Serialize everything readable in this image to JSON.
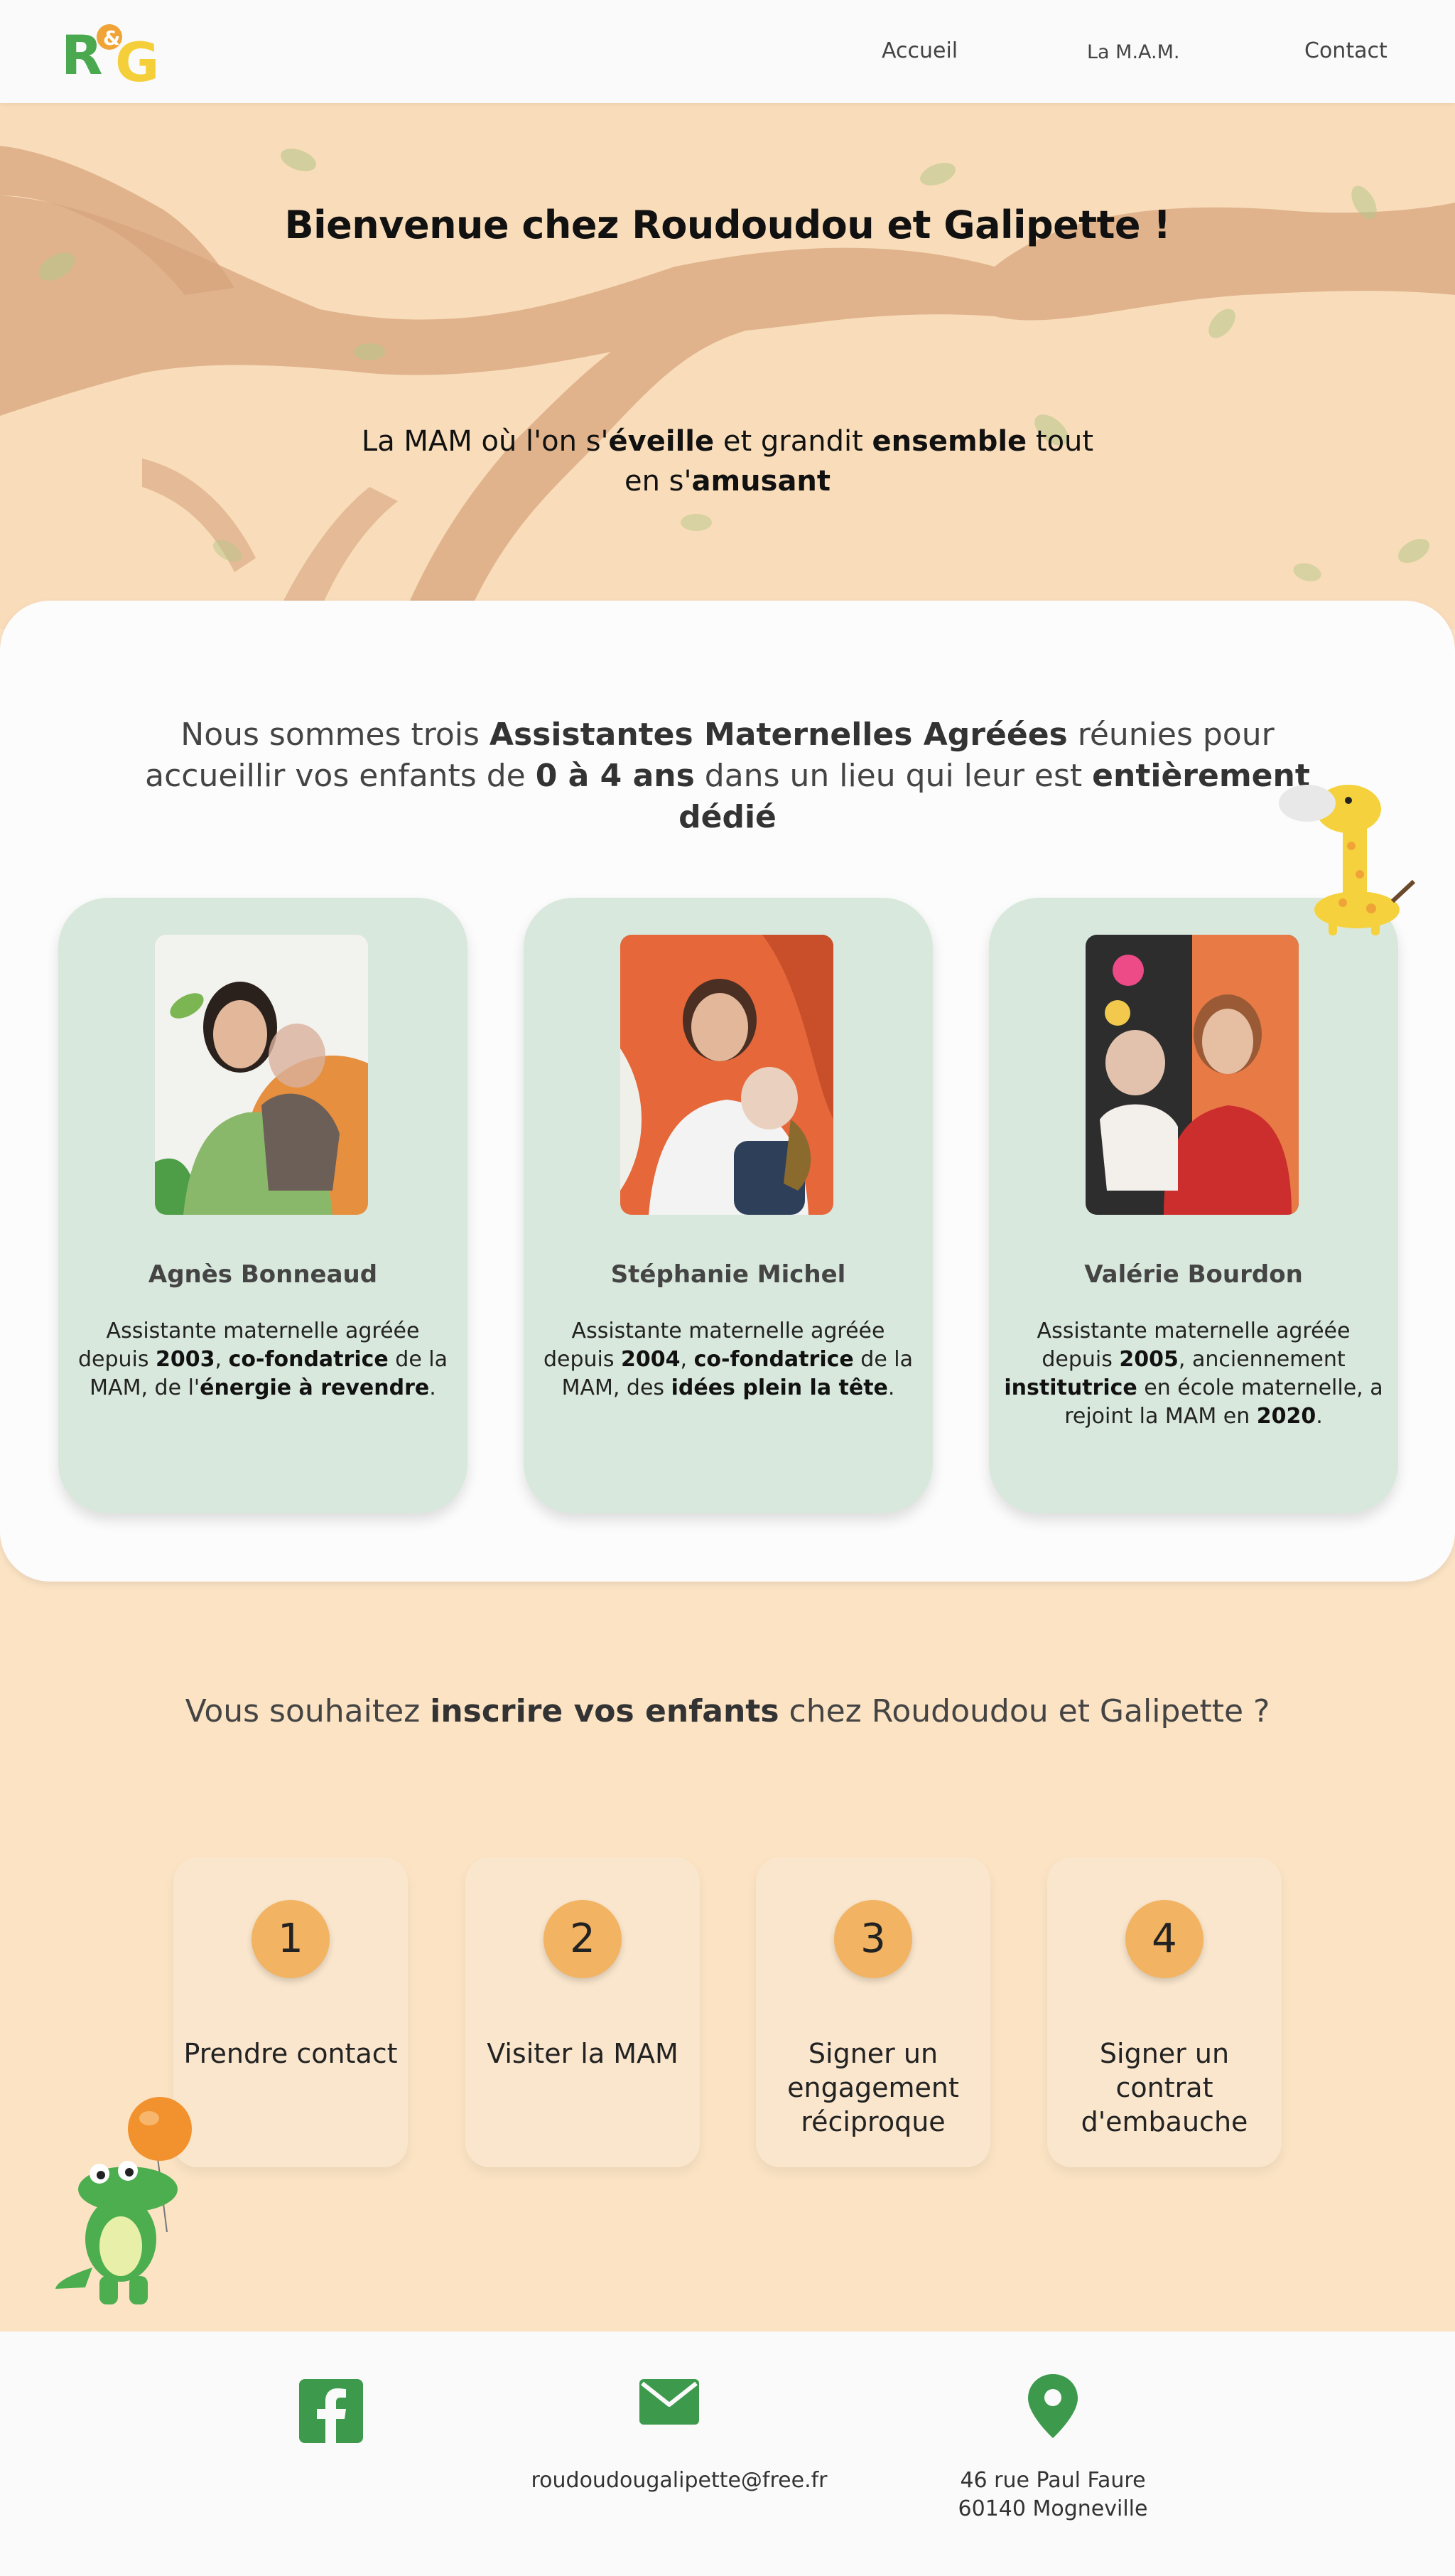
{
  "brand": {
    "logo_letter_1": "R",
    "logo_amp": "&",
    "logo_letter_2": "G"
  },
  "nav": {
    "items": [
      {
        "label": "Accueil"
      },
      {
        "label": "La M.A.M."
      },
      {
        "label": "Contact"
      }
    ]
  },
  "hero": {
    "title": "Bienvenue chez Roudoudou et Galipette !",
    "sub": {
      "p1": "La MAM où l'on s'",
      "b1": "éveille",
      "p2": " et grandit ",
      "b2": "ensemble",
      "p3": " tout en s'",
      "b3": "amusant"
    }
  },
  "team": {
    "intro": {
      "p1": "Nous sommes trois ",
      "b1": "Assistantes Maternelles Agréées",
      "p2": " réunies pour accueillir vos enfants de ",
      "b2": "0 à 4 ans",
      "p3": " dans un lieu qui leur est ",
      "b3": "entièrement dédié"
    },
    "members": [
      {
        "name": "Agnès Bonneaud",
        "d1": "Assistante maternelle agréée depuis ",
        "b1": "2003",
        "d2": ", ",
        "b2": "co-fondatrice",
        "d3": " de la MAM, de l'",
        "b3": "énergie à revendre",
        "d4": "."
      },
      {
        "name": "Stéphanie Michel",
        "d1": "Assistante maternelle agréée depuis ",
        "b1": "2004",
        "d2": ", ",
        "b2": "co-fondatrice",
        "d3": " de la MAM, des ",
        "b3": "idées plein la tête",
        "d4": "."
      },
      {
        "name": "Valérie Bourdon",
        "d1": "Assistante maternelle agréée depuis ",
        "b1": "2005",
        "d2": ", anciennement ",
        "b2": "institutrice",
        "d3": " en école maternelle, a rejoint la MAM en ",
        "b3": "2020",
        "d4": "."
      }
    ]
  },
  "steps": {
    "title": {
      "p1": "Vous souhaitez ",
      "b1": "inscrire vos enfants",
      "p2": " chez Roudoudou et Galipette ?"
    },
    "items": [
      {
        "num": "1",
        "label": "Prendre contact"
      },
      {
        "num": "2",
        "label": "Visiter la MAM"
      },
      {
        "num": "3",
        "label": "Signer un engagement réciproque"
      },
      {
        "num": "4",
        "label": "Signer un contrat d'embauche"
      }
    ]
  },
  "footer": {
    "email": "roudoudougalipette@free.fr",
    "address_line1": "46 rue Paul Faure",
    "address_line2": "60140 Mogneville",
    "icons": [
      "facebook-icon",
      "mail-icon",
      "map-pin-icon"
    ]
  },
  "colors": {
    "hero_bg": "#f9ddba",
    "card_green": "#d9e8dc",
    "step_circle": "#f2b363",
    "footer_green": "#3d9a4c",
    "page_bg": "#fbe3c4"
  }
}
